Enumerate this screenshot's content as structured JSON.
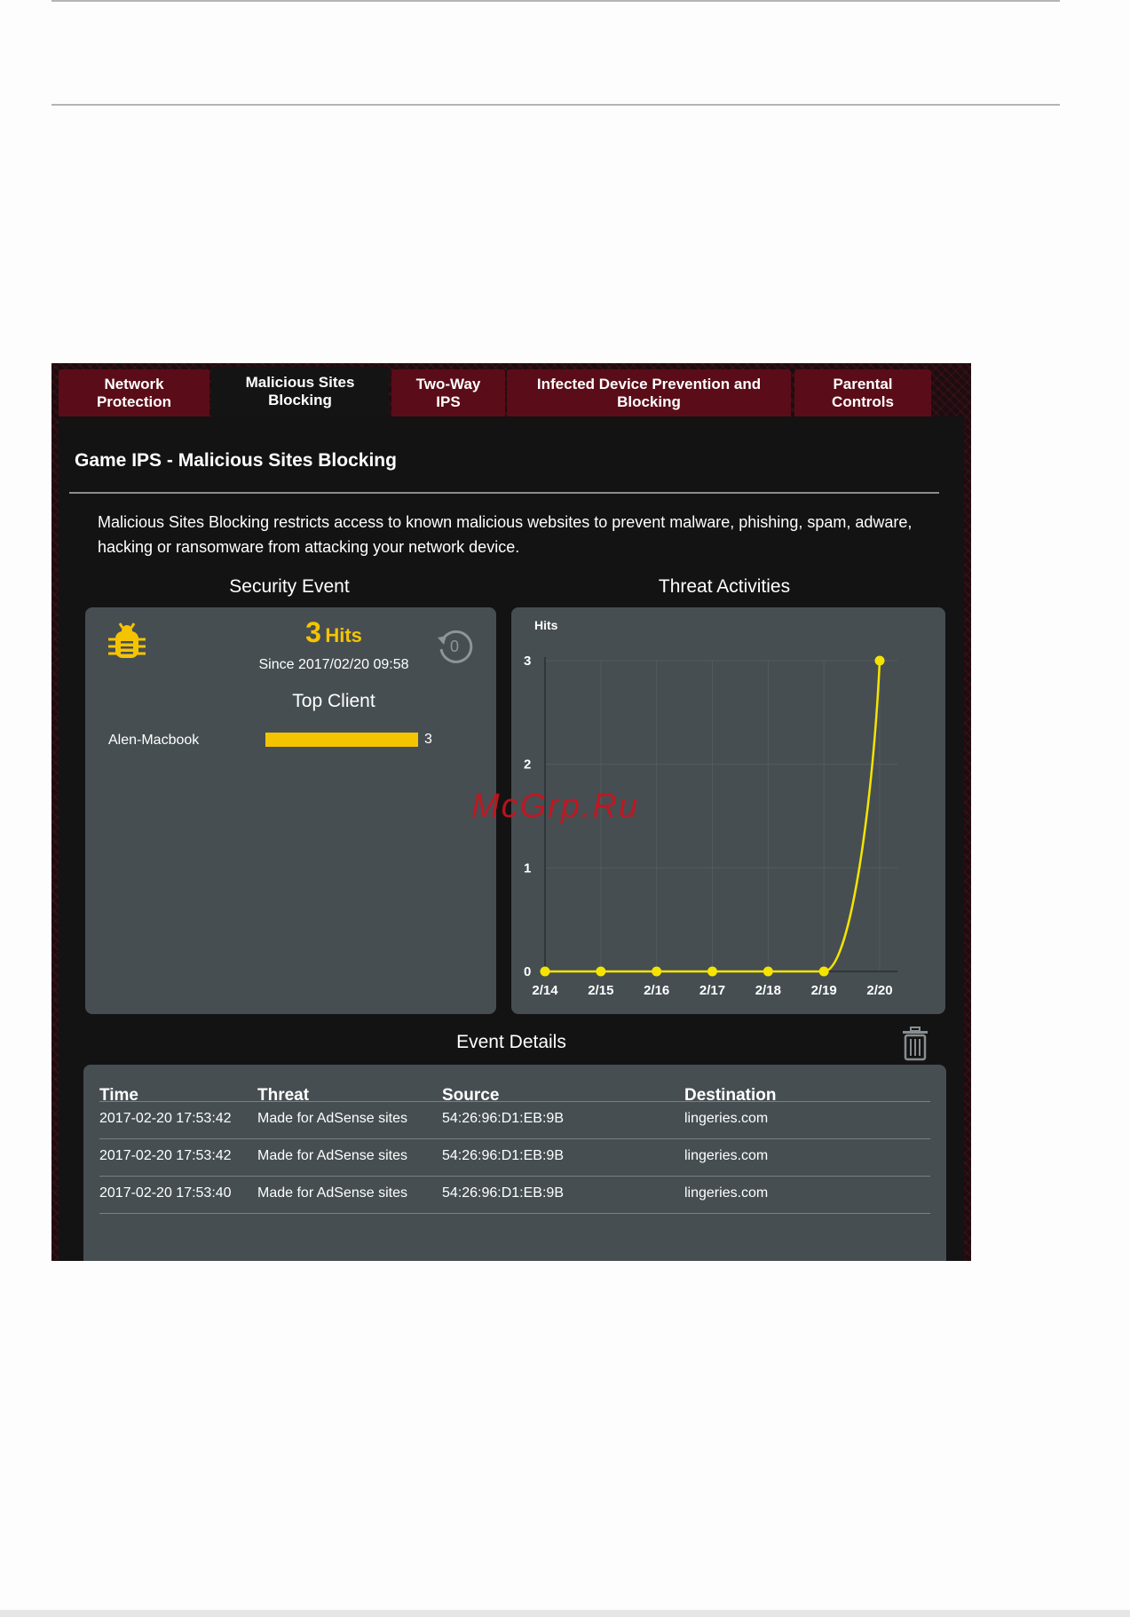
{
  "tabs": [
    {
      "label_1": "Network",
      "label_2": "Protection"
    },
    {
      "label_1": "Malicious Sites",
      "label_2": "Blocking"
    },
    {
      "label_1": "Two-Way",
      "label_2": "IPS"
    },
    {
      "label_1": "Infected Device Prevention and",
      "label_2": "Blocking"
    },
    {
      "label_1": "Parental",
      "label_2": "Controls"
    }
  ],
  "page": {
    "title": "Game IPS - Malicious Sites Blocking",
    "description": "Malicious Sites Blocking restricts access to known malicious websites to prevent malware, phishing, spam, adware, hacking or ransomware from attacking your network device."
  },
  "security_event": {
    "heading": "Security Event",
    "hits_count": "3",
    "hits_label": "Hits",
    "since": "Since 2017/02/20 09:58",
    "reset_label": "0",
    "top_client_heading": "Top Client",
    "clients": [
      {
        "name": "Alen-Macbook",
        "count": 3
      }
    ],
    "bar_color": "#f5c400",
    "bug_icon": "bug-icon"
  },
  "threat_activities": {
    "heading": "Threat Activities"
  },
  "chart_data": {
    "type": "line",
    "ylabel": "Hits",
    "categories": [
      "2/14",
      "2/15",
      "2/16",
      "2/17",
      "2/18",
      "2/19",
      "2/20"
    ],
    "values": [
      0,
      0,
      0,
      0,
      0,
      0,
      3
    ],
    "yticks": [
      "0",
      "1",
      "2",
      "3"
    ],
    "ylim": [
      0,
      3
    ],
    "grid": true,
    "line_color": "#f5e400"
  },
  "event_details": {
    "heading": "Event Details",
    "columns": [
      "Time",
      "Threat",
      "Source",
      "Destination"
    ],
    "rows": [
      [
        "2017-02-20 17:53:42",
        "Made for AdSense sites",
        "54:26:96:D1:EB:9B",
        "lingeries.com"
      ],
      [
        "2017-02-20 17:53:42",
        "Made for AdSense sites",
        "54:26:96:D1:EB:9B",
        "lingeries.com"
      ],
      [
        "2017-02-20 17:53:40",
        "Made for AdSense sites",
        "54:26:96:D1:EB:9B",
        "lingeries.com"
      ]
    ]
  },
  "watermark": "McGrp.Ru"
}
